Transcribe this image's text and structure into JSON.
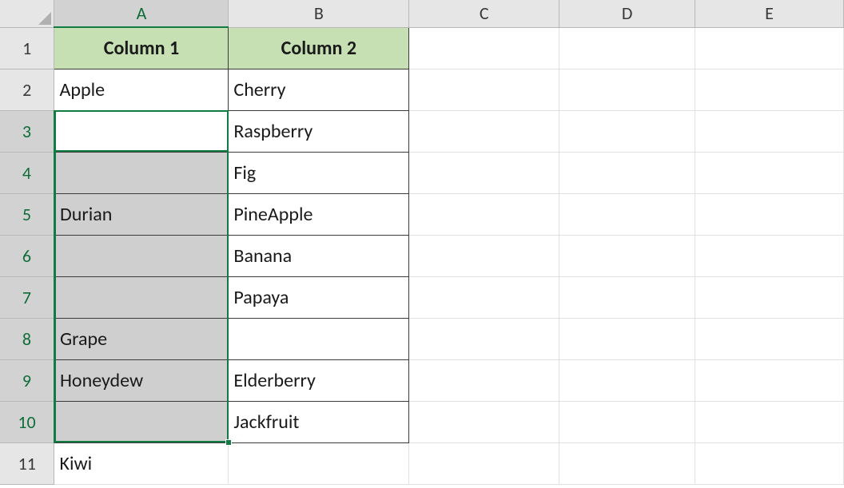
{
  "columns": [
    "A",
    "B",
    "C",
    "D",
    "E"
  ],
  "rows": [
    "1",
    "2",
    "3",
    "4",
    "5",
    "6",
    "7",
    "8",
    "9",
    "10",
    "11"
  ],
  "selected_column": "A",
  "selected_rows": [
    "3",
    "4",
    "5",
    "6",
    "7",
    "8",
    "9",
    "10"
  ],
  "active_cell": "A3",
  "header_row": {
    "A": "Column 1",
    "B": "Column 2"
  },
  "data": {
    "A2": "Apple",
    "B2": "Cherry",
    "A3": "",
    "B3": "Raspberry",
    "A4": "",
    "B4": "Fig",
    "A5": "Durian",
    "B5": "PineApple",
    "A6": "",
    "B6": "Banana",
    "A7": "",
    "B7": "Papaya",
    "A8": "Grape",
    "B8": "",
    "A9": "Honeydew",
    "B9": "Elderberry",
    "A10": "",
    "B10": "Jackfruit",
    "A11": "Kiwi",
    "B11": ""
  },
  "colors": {
    "header_fill": "#c6e0b4",
    "selection_fill": "#cfcfcf",
    "selection_border": "#107c41"
  },
  "chart_data": {
    "type": "table",
    "columns": [
      "Column 1",
      "Column 2"
    ],
    "rows": [
      [
        "Apple",
        "Cherry"
      ],
      [
        "",
        "Raspberry"
      ],
      [
        "",
        "Fig"
      ],
      [
        "Durian",
        "PineApple"
      ],
      [
        "",
        "Banana"
      ],
      [
        "",
        "Papaya"
      ],
      [
        "Grape",
        ""
      ],
      [
        "Honeydew",
        "Elderberry"
      ],
      [
        "",
        "Jackfruit"
      ],
      [
        "Kiwi",
        ""
      ]
    ]
  }
}
